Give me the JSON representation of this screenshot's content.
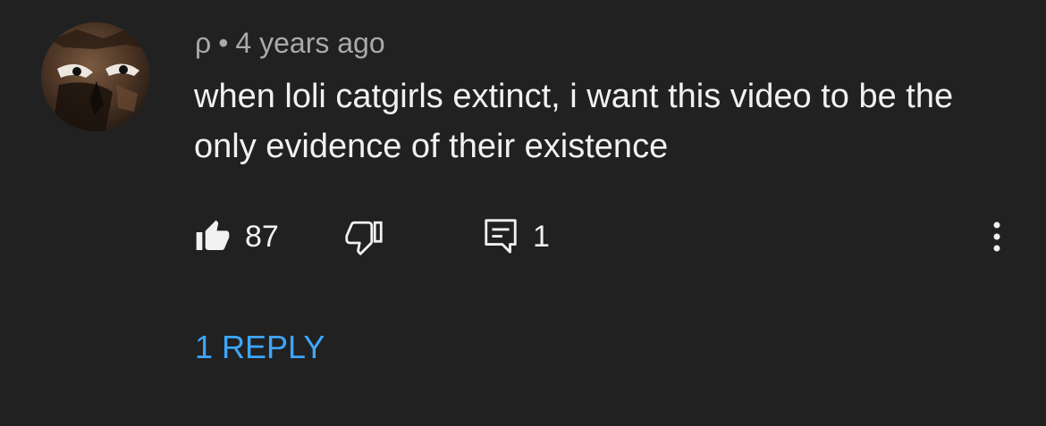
{
  "comment": {
    "author": "ρ",
    "separator": "•",
    "timestamp": "4 years ago",
    "text": "when loli catgirls extinct, i want this video to be the only evidence of their existence",
    "like_count": "87",
    "reply_count": "1",
    "view_replies_label": "1 REPLY"
  },
  "icons": {
    "avatar": "avatar-image",
    "like": "thumbs-up-icon",
    "dislike": "thumbs-down-icon",
    "replies": "comment-icon",
    "more": "more-vertical-icon"
  },
  "colors": {
    "background": "#212121",
    "text_primary": "#f1f1f1",
    "text_secondary": "#aaaaaa",
    "accent": "#3ea6ff"
  }
}
